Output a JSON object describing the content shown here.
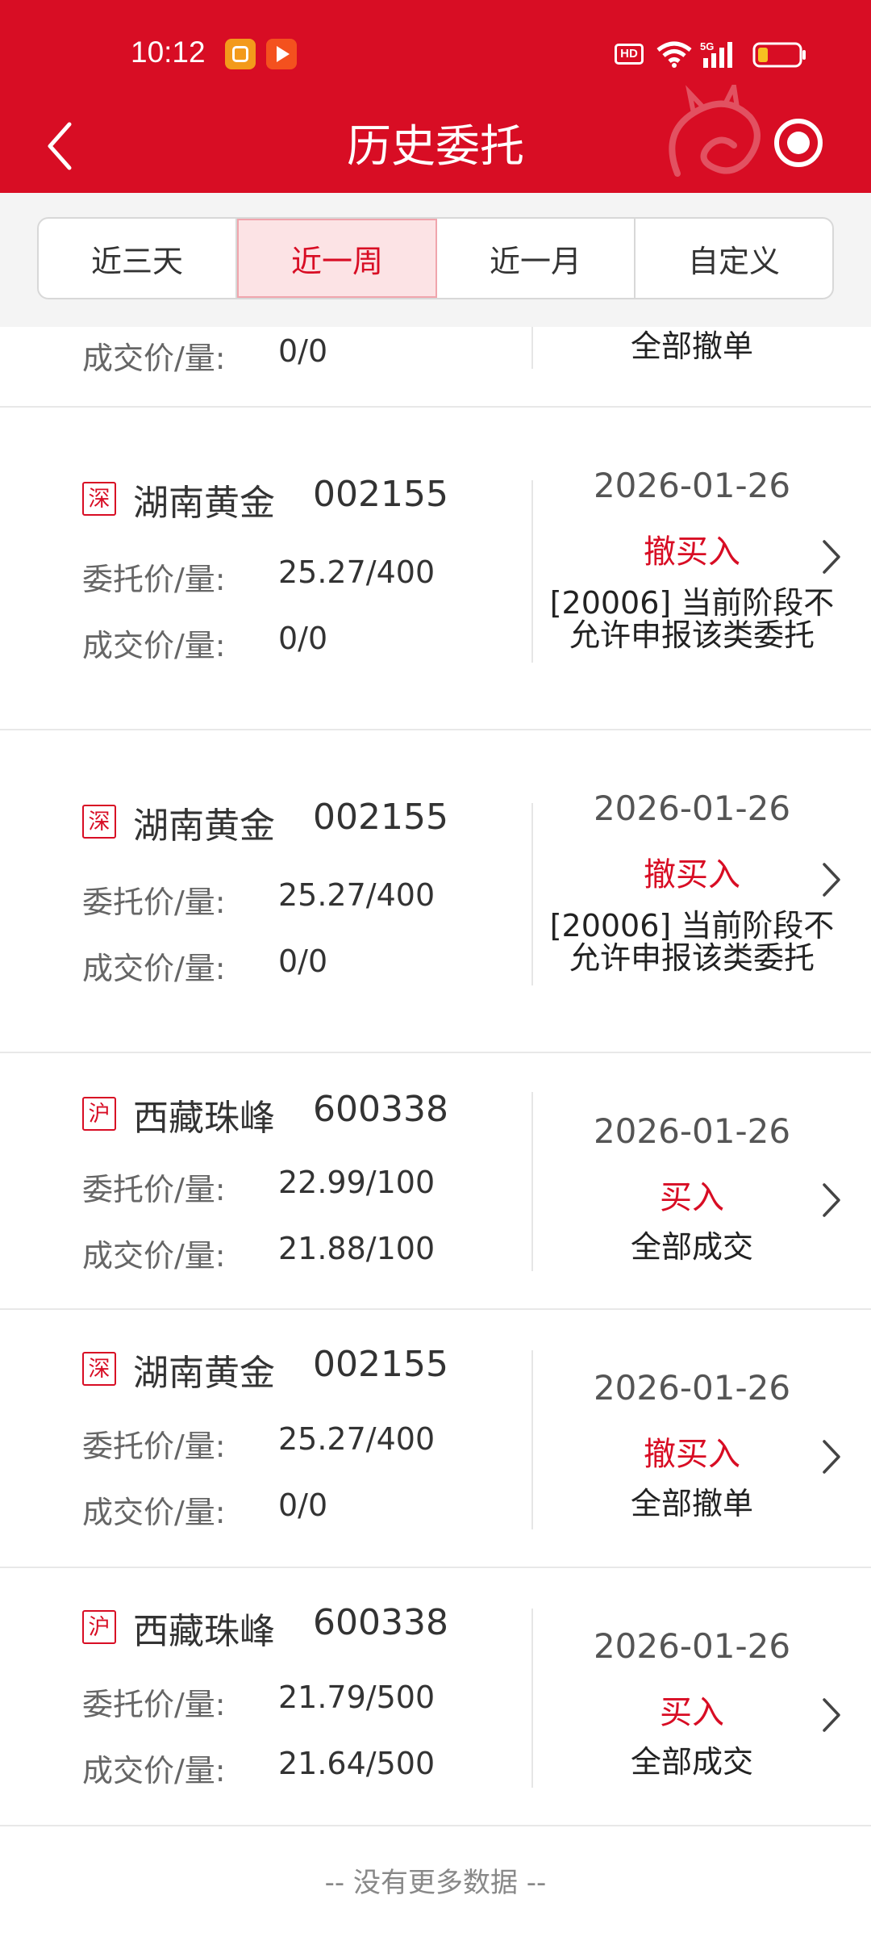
{
  "status_bar": {
    "time": "10:12",
    "hd": "HD",
    "network": "5G"
  },
  "header": {
    "title": "历史委托",
    "accent_color": "#d80d24"
  },
  "tabs": [
    {
      "label": "近三天",
      "active": false
    },
    {
      "label": "近一周",
      "active": true
    },
    {
      "label": "近一月",
      "active": false
    },
    {
      "label": "自定义",
      "active": false
    }
  ],
  "partial_row": {
    "deal_label": "成交价/量:",
    "deal_value": "0/0",
    "status": "全部撤单"
  },
  "orders": [
    {
      "market": "深",
      "name": "湖南黄金",
      "code": "002155",
      "order_label": "委托价/量:",
      "order_value": "25.27/400",
      "deal_label": "成交价/量:",
      "deal_value": "0/0",
      "date": "2026-01-26",
      "action": "撤买入",
      "status": "[20006] 当前阶段不允许申报该类委托"
    },
    {
      "market": "深",
      "name": "湖南黄金",
      "code": "002155",
      "order_label": "委托价/量:",
      "order_value": "25.27/400",
      "deal_label": "成交价/量:",
      "deal_value": "0/0",
      "date": "2026-01-26",
      "action": "撤买入",
      "status": "[20006] 当前阶段不允许申报该类委托"
    },
    {
      "market": "沪",
      "name": "西藏珠峰",
      "code": "600338",
      "order_label": "委托价/量:",
      "order_value": "22.99/100",
      "deal_label": "成交价/量:",
      "deal_value": "21.88/100",
      "date": "2026-01-26",
      "action": "买入",
      "status": "全部成交"
    },
    {
      "market": "深",
      "name": "湖南黄金",
      "code": "002155",
      "order_label": "委托价/量:",
      "order_value": "25.27/400",
      "deal_label": "成交价/量:",
      "deal_value": "0/0",
      "date": "2026-01-26",
      "action": "撤买入",
      "status": "全部撤单"
    },
    {
      "market": "沪",
      "name": "西藏珠峰",
      "code": "600338",
      "order_label": "委托价/量:",
      "order_value": "21.79/500",
      "deal_label": "成交价/量:",
      "deal_value": "21.64/500",
      "date": "2026-01-26",
      "action": "买入",
      "status": "全部成交"
    }
  ],
  "footer": {
    "text": "-- 没有更多数据 --"
  }
}
